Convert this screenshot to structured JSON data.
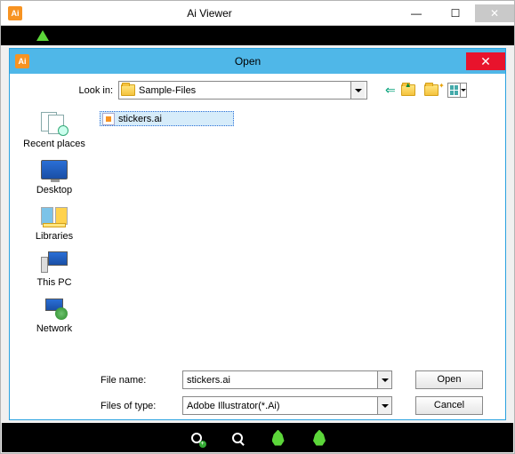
{
  "parent_window": {
    "title": "Ai Viewer",
    "icon_text": "Ai"
  },
  "dialog": {
    "title": "Open",
    "icon_text": "Ai",
    "lookin_label": "Look in:",
    "lookin_value": "Sample-Files",
    "places": {
      "recent": "Recent places",
      "desktop": "Desktop",
      "libraries": "Libraries",
      "thispc": "This PC",
      "network": "Network"
    },
    "files": [
      {
        "name": "stickers.ai"
      }
    ],
    "filename_label": "File name:",
    "filename_value": "stickers.ai",
    "filetype_label": "Files of type:",
    "filetype_value": "Adobe Illustrator(*.Ai)",
    "open_btn": "Open",
    "cancel_btn": "Cancel"
  }
}
